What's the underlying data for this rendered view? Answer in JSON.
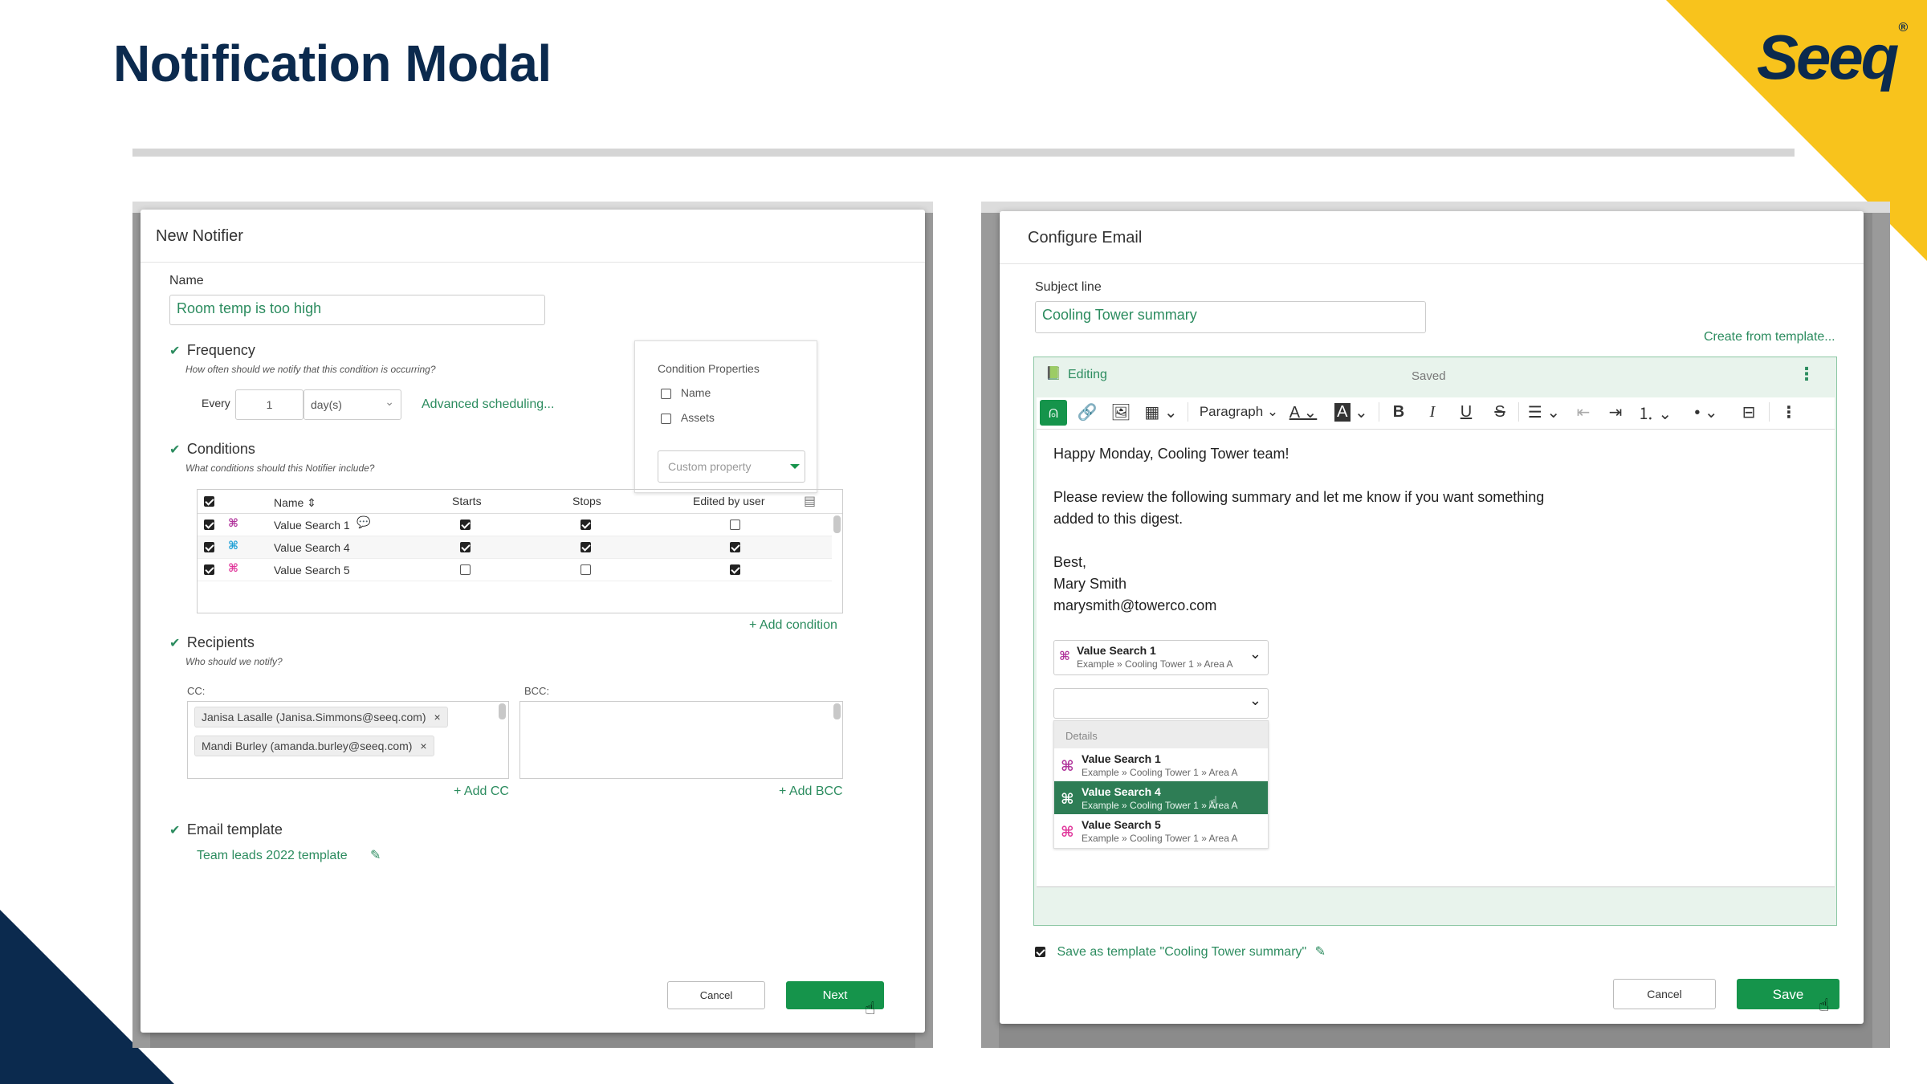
{
  "slide": {
    "title": "Notification Modal",
    "logo": "Seeq"
  },
  "notifier": {
    "header": "New Notifier",
    "name_label": "Name",
    "name_value": "Room temp is too high",
    "frequency": {
      "title": "Frequency",
      "hint": "How often should we notify that this condition is occurring?",
      "every_label": "Every",
      "every_value": "1",
      "unit": "day(s)",
      "advanced_link": "Advanced scheduling..."
    },
    "condition_properties": {
      "title": "Condition Properties",
      "options": [
        "Name",
        "Assets"
      ],
      "custom_placeholder": "Custom property"
    },
    "conditions": {
      "title": "Conditions",
      "hint": "What conditions should this Notifier include?",
      "columns": [
        "Name",
        "Starts",
        "Stops",
        "Edited by user"
      ],
      "rows": [
        {
          "name": "Value Search 1",
          "starts": true,
          "stops": true,
          "edited": false
        },
        {
          "name": "Value Search 4",
          "starts": true,
          "stops": true,
          "edited": true
        },
        {
          "name": "Value Search 5",
          "starts": false,
          "stops": false,
          "edited": true
        }
      ],
      "add_link": "+ Add condition"
    },
    "recipients": {
      "title": "Recipients",
      "hint": "Who should we notify?",
      "cc_label": "CC:",
      "bcc_label": "BCC:",
      "cc": [
        "Janisa Lasalle (Janisa.Simmons@seeq.com)",
        "Mandi Burley (amanda.burley@seeq.com)"
      ],
      "add_cc": "+ Add CC",
      "add_bcc": "+ Add BCC"
    },
    "email_template": {
      "title": "Email template",
      "value": "Team leads 2022 template"
    },
    "cancel_label": "Cancel",
    "next_label": "Next"
  },
  "email": {
    "header": "Configure Email",
    "subject_label": "Subject line",
    "subject_value": "Cooling Tower summary",
    "create_template": "Create from template...",
    "editing_label": "Editing",
    "saved_label": "Saved",
    "paragraph_label": "Paragraph",
    "body": {
      "greeting": "Happy Monday, Cooling Tower team!",
      "line1": "Please review the following summary and let me know if you want something",
      "line2": "added to this digest.",
      "sign1": "Best,",
      "sign2": "Mary Smith",
      "sign3": "marysmith@towerco.com"
    },
    "selected_item": {
      "name": "Value Search 1",
      "path": "Example » Cooling Tower 1 » Area A"
    },
    "dropdown": {
      "section": "Details",
      "items": [
        {
          "name": "Value Search 1",
          "path": "Example » Cooling Tower 1 » Area A"
        },
        {
          "name": "Value Search 4",
          "path": "Example » Cooling Tower 1 » Area A"
        },
        {
          "name": "Value Search 5",
          "path": "Example » Cooling Tower 1 » Area A"
        }
      ]
    },
    "save_template": "Save as template \"Cooling Tower summary\"",
    "cancel_label": "Cancel",
    "save_label": "Save"
  },
  "colors": {
    "brand_navy": "#0b2a4e",
    "brand_yellow": "#f8c31c",
    "green": "#15944b",
    "link_green": "#2c8c5f"
  }
}
